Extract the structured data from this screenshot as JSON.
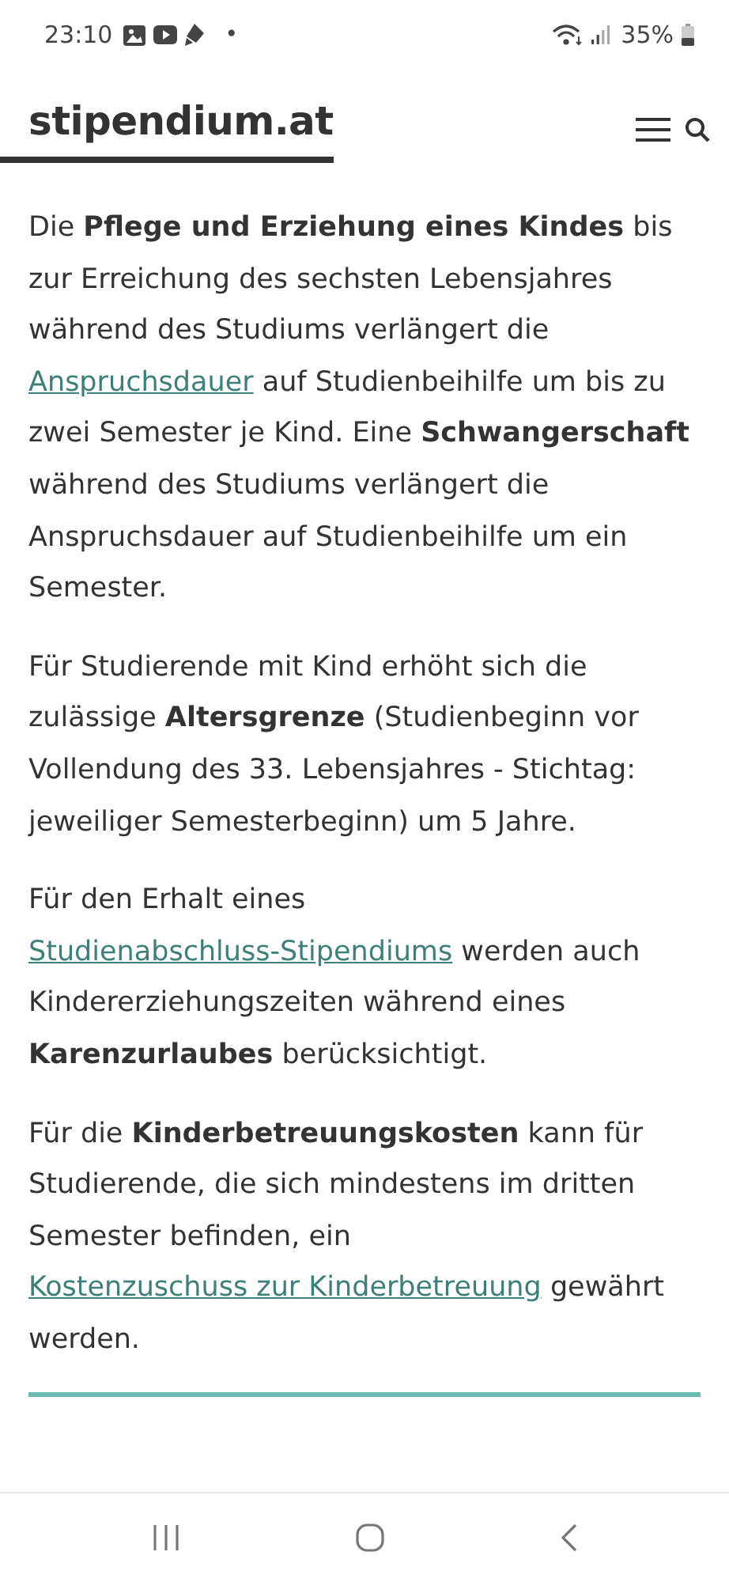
{
  "status_bar": {
    "time": "23:10",
    "dot": "•",
    "battery": "35%"
  },
  "header": {
    "logo": "stipendium.at"
  },
  "paragraphs": [
    [
      {
        "kind": "text",
        "text": "Die **Pflege und Erziehung eines Kindes** bis zur Erreichung des sechsten Lebensjahres während des Studiums verlängert die "
      },
      {
        "kind": "link",
        "text": "Anspruchsdauer"
      },
      {
        "kind": "text",
        "text": " auf Studienbeihilfe um bis zu zwei Semester je Kind. Eine **Schwangerschaft** während des Studiums verlängert die Anspruchsdauer auf Studienbeihilfe um ein Semester."
      }
    ],
    [
      {
        "kind": "text",
        "text": "Für Studierende mit Kind erhöht sich die zulässige **Altersgrenze** (Studienbeginn vor Vollendung des 33. Lebensjahres - Stichtag: jeweiliger Semesterbeginn) um 5 Jahre."
      }
    ],
    [
      {
        "kind": "text",
        "text": "Für den Erhalt eines "
      },
      {
        "kind": "link",
        "text": "Studienabschluss-Stipendiums"
      },
      {
        "kind": "text",
        "text": " werden auch Kindererziehungszeiten während eines **Karenzurlaubes** berücksichtigt."
      }
    ],
    [
      {
        "kind": "text",
        "text": "Für die **Kinderbetreuungskosten** kann für Studierende, die sich mindestens im dritten Semester befinden, ein "
      },
      {
        "kind": "link",
        "text": "Kostenzuschuss zur Kinderbetreuung"
      },
      {
        "kind": "text",
        "text": " gewährt werden."
      }
    ]
  ]
}
